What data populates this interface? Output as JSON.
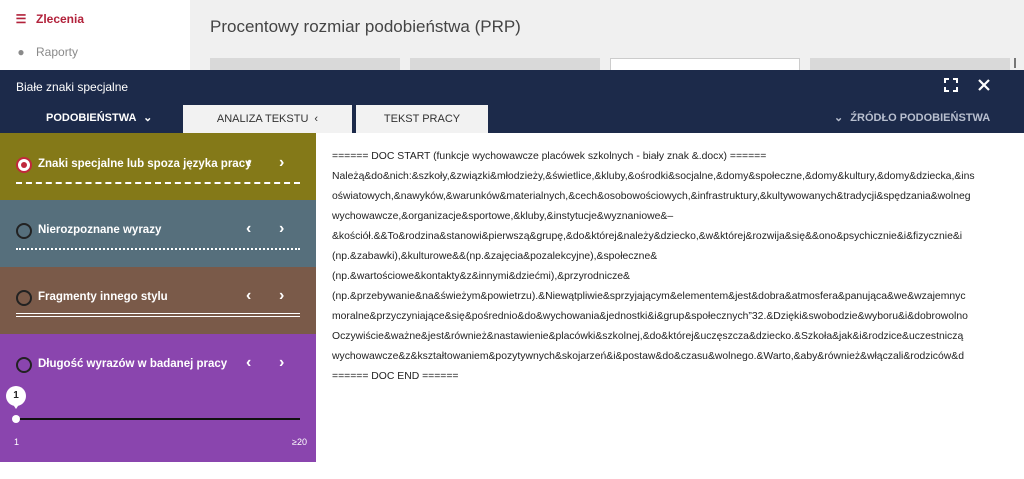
{
  "nav": {
    "items": [
      {
        "label": "Zlecenia",
        "icon": "list-icon"
      },
      {
        "label": "Raporty",
        "icon": "info-icon"
      }
    ]
  },
  "page_title": "Procentowy rozmiar podobieństwa (PRP)",
  "modal": {
    "title": "Białe znaki specjalne",
    "tabs": {
      "similarities": "PODOBIEŃSTWA",
      "text_analysis": "ANALIZA TEKSTU",
      "work_text": "TEKST PRACY",
      "source": "ŹRÓDŁO PODOBIEŃSTWA"
    },
    "panels": [
      {
        "label": "Znaki specjalne lub spoza języka pracy",
        "selected": true,
        "color": "#847918"
      },
      {
        "label": "Nierozpoznane wyrazy",
        "selected": false,
        "color": "#566f7c"
      },
      {
        "label": "Fragmenty innego stylu",
        "selected": false,
        "color": "#7a5a49"
      },
      {
        "label": "Długość wyrazów w badanej pracy",
        "selected": false,
        "color": "#8a45ae"
      }
    ],
    "slider": {
      "value": "1",
      "min_label": "1",
      "max_label": "≥20"
    },
    "document_lines": [
      "====== DOC START (funkcje wychowawcze placówek szkolnych - biały znak &.docx) ======",
      "Należą&do&nich:&szkoły,&związki&młodzieży,&świetlice,&kluby,&ośrodki&socjalne,&domy&społeczne,&domy&kultury,&domy&dziecka,&ins",
      "oświatowych,&nawyków,&warunków&materialnych,&cech&osobowościowych,&infrastruktury,&kultywowanych&tradycji&spędzania&wolneg",
      "wychowawcze,&organizacje&sportowe,&kluby,&instytucje&wyznaniowe&–",
      "&kościół.&&To&rodzina&stanowi&pierwszą&grupę,&do&której&należy&dziecko,&w&której&rozwija&się&&ono&psychicznie&i&fizycznie&i",
      "(np.&zabawki),&kulturowe&&(np.&zajęcia&pozalekcyjne),&społeczne&",
      "(np.&wartościowe&kontakty&z&innymi&dziećmi),&przyrodnicze&",
      "(np.&przebywanie&na&świeżym&powietrzu).&Niewątpliwie&sprzyjającym&elementem&jest&dobra&atmosfera&panująca&we&wzajemnyc",
      "moralne&przyczyniające&się&pośrednio&do&wychowania&jednostki&i&grup&społecznych”32.&Dzięki&swobodzie&wyboru&i&dobrowolno",
      "Oczywiście&ważne&jest&również&nastawienie&placówki&szkolnej,&do&której&uczęszcza&dziecko.&Szkoła&jak&i&rodzice&uczestniczą",
      "wychowawcze&z&kształtowaniem&pozytywnych&skojarzeń&i&postaw&do&czasu&wolnego.&Warto,&aby&również&włączali&rodziców&d",
      "====== DOC END ======"
    ]
  }
}
